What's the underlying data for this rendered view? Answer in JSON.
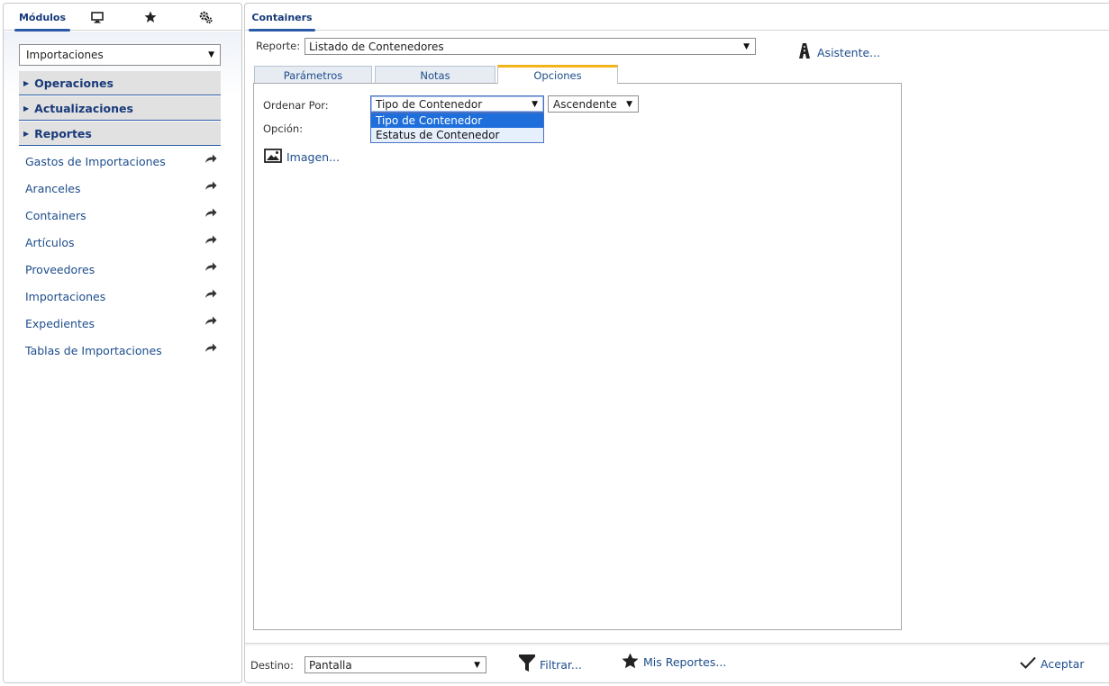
{
  "left_panel": {
    "tabs": [
      {
        "label": "Módulos",
        "icon": ""
      },
      {
        "label": "",
        "icon": "monitor-icon"
      },
      {
        "label": "",
        "icon": "star-icon"
      },
      {
        "label": "",
        "icon": "gears-icon"
      }
    ],
    "module_select": {
      "value": "Importaciones"
    },
    "sections": [
      {
        "label": "Operaciones"
      },
      {
        "label": "Actualizaciones"
      },
      {
        "label": "Reportes"
      }
    ],
    "items": [
      {
        "label": "Gastos de Importaciones"
      },
      {
        "label": "Aranceles"
      },
      {
        "label": "Containers"
      },
      {
        "label": "Artículos"
      },
      {
        "label": "Proveedores"
      },
      {
        "label": "Importaciones"
      },
      {
        "label": "Expedientes"
      },
      {
        "label": "Tablas de Importaciones"
      }
    ]
  },
  "main": {
    "tab_title": "Containers",
    "report_label": "Reporte:",
    "report_value": "Listado de Contenedores",
    "wizard_label": "Asistente...",
    "sub_tabs": [
      {
        "label": "Parámetros",
        "active": false
      },
      {
        "label": "Notas",
        "active": false
      },
      {
        "label": "Opciones",
        "active": true
      }
    ],
    "options": {
      "order_label": "Ordenar Por:",
      "order_value": "Tipo de Contenedor",
      "order_options": [
        "Tipo de Contenedor",
        "Estatus de Contenedor"
      ],
      "direction_value": "Ascendente",
      "option_label": "Opción:",
      "image_label": "Imagen..."
    },
    "footer": {
      "dest_label": "Destino:",
      "dest_value": "Pantalla",
      "filter_label": "Filtrar...",
      "my_reports_label": "Mis Reportes...",
      "accept_label": "Aceptar"
    }
  },
  "colors": {
    "link": "#1d4d8c",
    "accent": "#2a5aa6",
    "active_tab_border": "#f2b418",
    "selected_option": "#1e6fdc"
  }
}
